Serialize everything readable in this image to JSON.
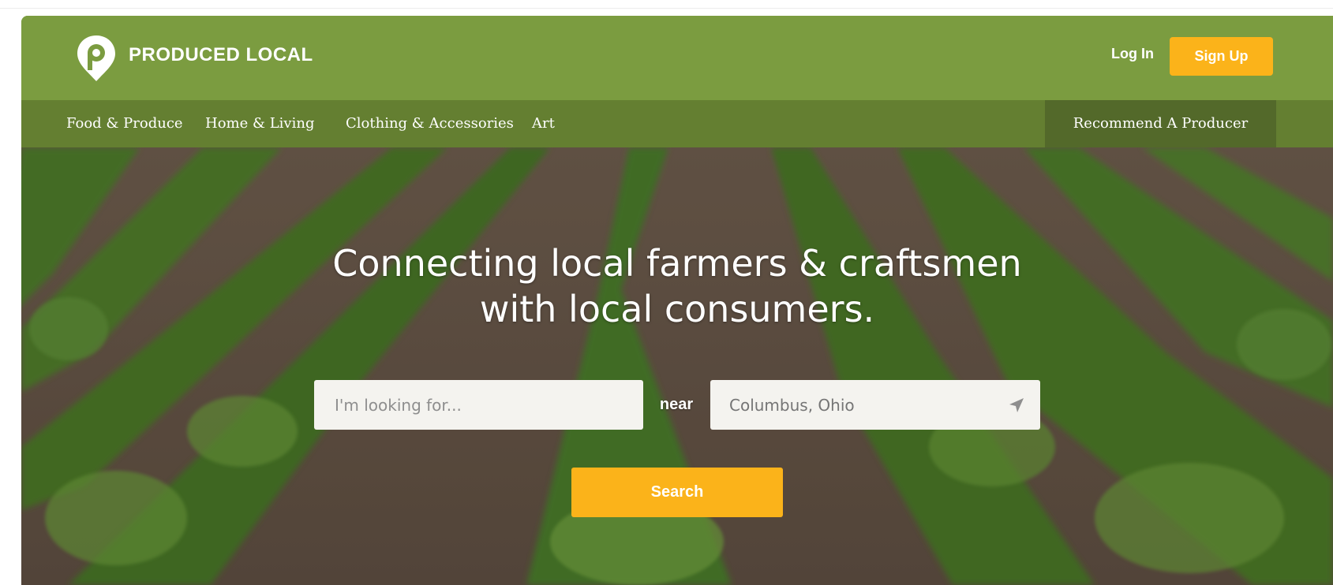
{
  "brand": {
    "name": "PRODUCED LOCAL",
    "color": "#7b9c40",
    "accent": "#fbb31a",
    "logo_icon": "map-pin-p-icon"
  },
  "header": {
    "login_label": "Log In",
    "signup_label": "Sign Up"
  },
  "nav": {
    "items": [
      {
        "label": "Food & Produce"
      },
      {
        "label": "Home & Living"
      },
      {
        "label": "Clothing & Accessories"
      },
      {
        "label": "Art"
      }
    ],
    "recommend_label": "Recommend A Producer"
  },
  "hero": {
    "title_line1": "Connecting local farmers & craftsmen",
    "title_line2": "with local consumers.",
    "search_placeholder": "I'm looking for...",
    "near_label": "near",
    "location_placeholder": "Columbus, Ohio",
    "location_icon": "location-arrow-icon",
    "search_button_label": "Search"
  }
}
